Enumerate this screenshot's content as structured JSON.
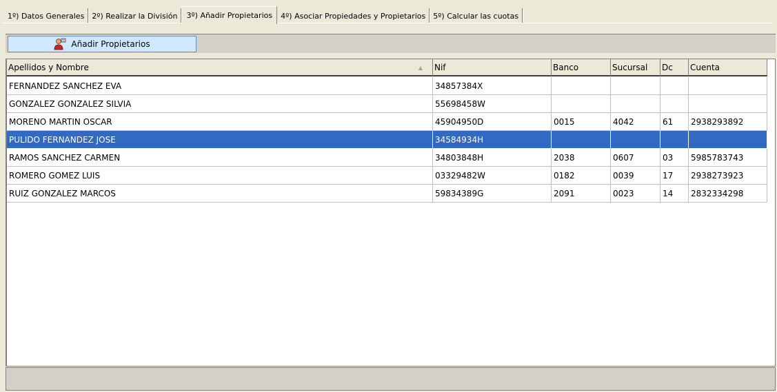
{
  "tabs": [
    {
      "label": "1º) Datos Generales"
    },
    {
      "label": "2º) Realizar la División"
    },
    {
      "label": "3º) Añadir Propietarios"
    },
    {
      "label": "4º) Asociar Propiedades y Propietarios"
    },
    {
      "label": "5º) Calcular las cuotas"
    }
  ],
  "active_tab": 2,
  "toolbar": {
    "add_owners_label": "Añadir Propietarios",
    "add_owners_icon": "add-user-icon"
  },
  "grid": {
    "columns": [
      "Apellidos y Nombre",
      "Nif",
      "Banco",
      "Sucursal",
      "Dc",
      "Cuenta"
    ],
    "sort_indicator": "▲",
    "rows": [
      [
        "FERNANDEZ SANCHEZ EVA",
        "34857384X",
        "",
        "",
        "",
        ""
      ],
      [
        "GONZALEZ GONZALEZ SILVIA",
        "55698458W",
        "",
        "",
        "",
        ""
      ],
      [
        "MORENO MARTIN OSCAR",
        "45904950D",
        "0015",
        "4042",
        "61",
        "2938293892"
      ],
      [
        "PULIDO FERNANDEZ JOSE",
        "34584934H",
        "",
        "",
        "",
        ""
      ],
      [
        "RAMOS SANCHEZ CARMEN",
        "34803848H",
        "2038",
        "0607",
        "03",
        "5985783743"
      ],
      [
        "ROMERO GOMEZ LUIS",
        "03329482W",
        "0182",
        "0039",
        "17",
        "2938273923"
      ],
      [
        "RUIZ GONZALEZ MARCOS",
        "59834389G",
        "2091",
        "0023",
        "14",
        "2832334298"
      ]
    ],
    "selected_row": 3
  },
  "colors": {
    "selection": "#316ac5",
    "button_bg": "#cfe8ff",
    "window_bg": "#ece9d8"
  }
}
